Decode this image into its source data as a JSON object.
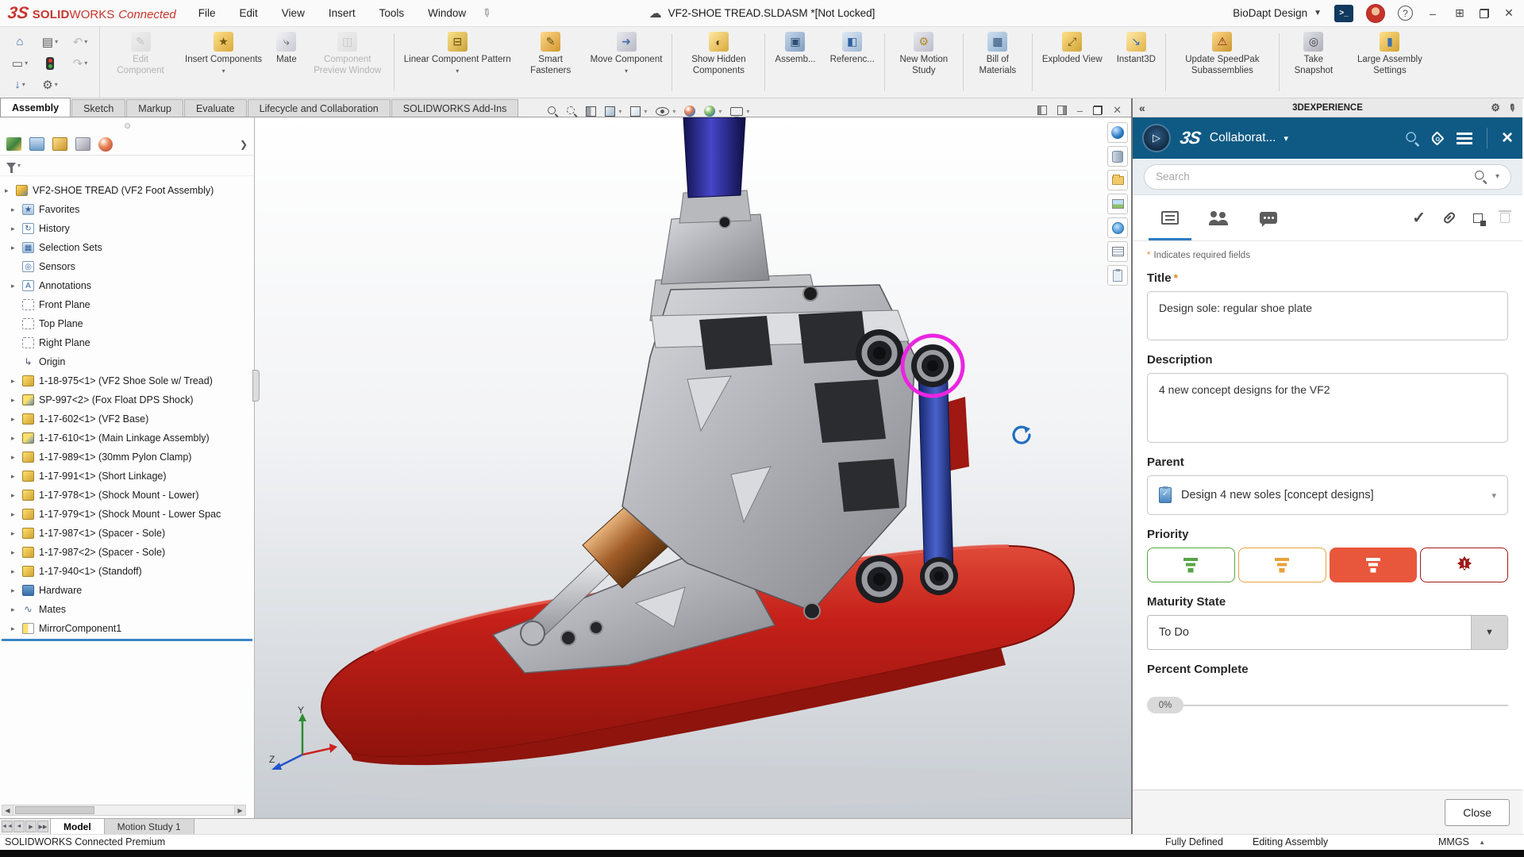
{
  "title_bar": {
    "logo_3s": "3S",
    "app_solid": "SOLID",
    "app_works": "WORKS",
    "app_connected": "Connected",
    "menus": [
      {
        "label": "File"
      },
      {
        "label": "Edit"
      },
      {
        "label": "View"
      },
      {
        "label": "Insert"
      },
      {
        "label": "Tools"
      },
      {
        "label": "Window"
      }
    ],
    "document": "VF2-SHOE TREAD.SLDASM *[Not Locked]",
    "workspace": "BioDapt Design",
    "terminal_glyph": ">_",
    "help_glyph": "?"
  },
  "ribbon": {
    "buttons": [
      {
        "label": "Edit Component"
      },
      {
        "label": "Insert Components"
      },
      {
        "label": "Mate"
      },
      {
        "label": "Component Preview Window"
      },
      {
        "label": "Linear Component Pattern"
      },
      {
        "label": "Smart Fasteners"
      },
      {
        "label": "Move Component"
      },
      {
        "label": "Show Hidden Components"
      },
      {
        "label": "Assemb..."
      },
      {
        "label": "Referenc..."
      },
      {
        "label": "New Motion Study"
      },
      {
        "label": "Bill of Materials"
      },
      {
        "label": "Exploded View"
      },
      {
        "label": "Instant3D"
      },
      {
        "label": "Update SpeedPak Subassemblies"
      },
      {
        "label": "Take Snapshot"
      },
      {
        "label": "Large Assembly Settings"
      }
    ]
  },
  "tabs": [
    {
      "label": "Assembly"
    },
    {
      "label": "Sketch"
    },
    {
      "label": "Markup"
    },
    {
      "label": "Evaluate"
    },
    {
      "label": "Lifecycle and Collaboration"
    },
    {
      "label": "SOLIDWORKS Add-Ins"
    }
  ],
  "feature_tree": {
    "root": "VF2-SHOE TREAD (VF2 Foot Assembly)",
    "items": [
      {
        "label": "Favorites"
      },
      {
        "label": "History"
      },
      {
        "label": "Selection Sets"
      },
      {
        "label": "Sensors"
      },
      {
        "label": "Annotations"
      },
      {
        "label": "Front Plane"
      },
      {
        "label": "Top Plane"
      },
      {
        "label": "Right Plane"
      },
      {
        "label": "Origin"
      },
      {
        "label": "1-18-975<1> (VF2 Shoe Sole w/ Tread)"
      },
      {
        "label": "SP-997<2> (Fox Float DPS Shock)"
      },
      {
        "label": "1-17-602<1> (VF2 Base)"
      },
      {
        "label": "1-17-610<1> (Main Linkage Assembly)"
      },
      {
        "label": "1-17-989<1> (30mm Pylon Clamp)"
      },
      {
        "label": "1-17-991<1> (Short Linkage)"
      },
      {
        "label": "1-17-978<1> (Shock Mount - Lower)"
      },
      {
        "label": "1-17-979<1> (Shock Mount - Lower Spac"
      },
      {
        "label": "1-17-987<1> (Spacer - Sole)"
      },
      {
        "label": "1-17-987<2> (Spacer - Sole)"
      },
      {
        "label": "1-17-940<1> (Standoff)"
      },
      {
        "label": "Hardware"
      },
      {
        "label": "Mates"
      },
      {
        "label": "MirrorComponent1"
      }
    ]
  },
  "viewport": {
    "triad_y": "Y",
    "triad_z": "Z"
  },
  "dx_panel": {
    "header_title": "3DEXPERIENCE",
    "collapse_glyph": "«",
    "logo": "3S",
    "app_name": "Collaborat...",
    "search_placeholder": "Search",
    "required_star": "*",
    "required_note": "Indicates required fields",
    "title_label": "Title",
    "title_value": "Design sole: regular shoe plate",
    "description_label": "Description",
    "description_value": "4 new concept designs for the VF2",
    "parent_label": "Parent",
    "parent_value": "Design 4 new soles [concept designs]",
    "priority_label": "Priority",
    "maturity_label": "Maturity State",
    "maturity_value": "To Do",
    "percent_label": "Percent Complete",
    "percent_value": "0%",
    "close_label": "Close"
  },
  "bottom_tabs": {
    "model": "Model",
    "motion": "Motion Study 1"
  },
  "status_bar": {
    "left": "SOLIDWORKS Connected Premium",
    "defined": "Fully Defined",
    "editing": "Editing Assembly",
    "units": "MMGS"
  },
  "colors": {
    "brand_red": "#c8352c",
    "dx_blue": "#0e5a84",
    "accent_blue": "#2e7cc1",
    "priority_green": "#57a546",
    "priority_orange": "#e8a23c",
    "priority_high_selected": "#e8573c",
    "priority_critical": "#9e1b1b",
    "sole_red": "#c42019",
    "highlight_magenta": "#ea25e0",
    "pylon_blue": "#3a3ab8"
  }
}
